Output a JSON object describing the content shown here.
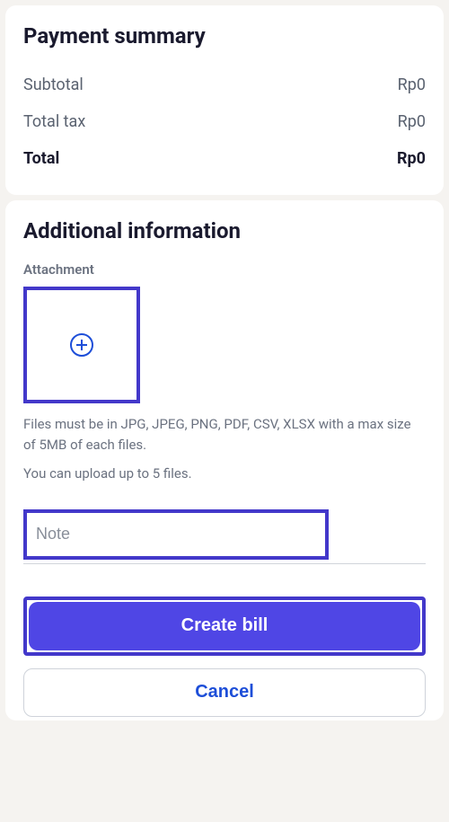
{
  "paymentSummary": {
    "title": "Payment summary",
    "subtotalLabel": "Subtotal",
    "subtotalValue": "Rp0",
    "totalTaxLabel": "Total tax",
    "totalTaxValue": "Rp0",
    "totalLabel": "Total",
    "totalValue": "Rp0"
  },
  "additionalInfo": {
    "title": "Additional information",
    "attachmentLabel": "Attachment",
    "fileHint": "Files must be in JPG, JPEG, PNG, PDF, CSV, XLSX with a max size of 5MB of each files.",
    "uploadHint": "You can upload up to 5 files.",
    "notePlaceholder": "Note"
  },
  "actions": {
    "createLabel": "Create bill",
    "cancelLabel": "Cancel"
  }
}
